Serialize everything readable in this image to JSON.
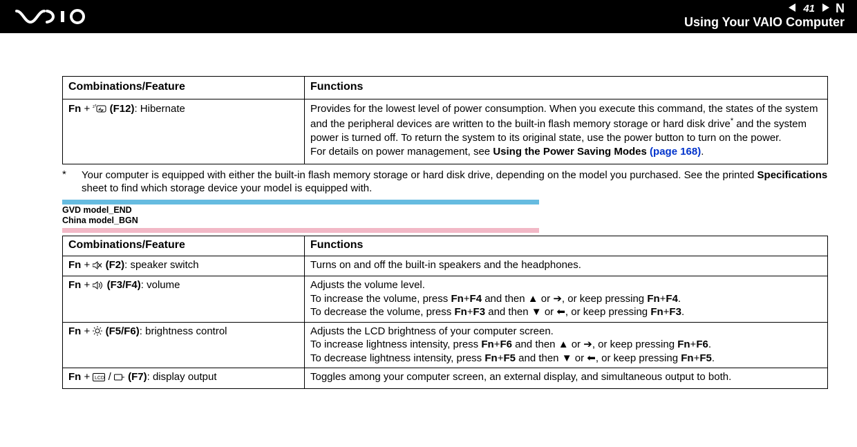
{
  "header": {
    "page_number": "41",
    "title": "Using Your VAIO Computer"
  },
  "table1": {
    "head_left": "Combinations/Feature",
    "head_right": "Functions",
    "row1_left_prefix": "Fn",
    "row1_left_plus": " + ",
    "row1_left_key": " (F12)",
    "row1_left_suffix": ": Hibernate",
    "row1_right_p1": "Provides for the lowest level of power consumption. When you execute this command, the states of the system and the peripheral devices are written to the built-in flash memory storage or hard disk drive",
    "row1_right_sup": "*",
    "row1_right_p1b": " and the system power is turned off. To return the system to its original state, use the power button to turn on the power.",
    "row1_right_p2a": "For details on power management, see ",
    "row1_right_p2b": "Using the Power Saving Modes ",
    "row1_right_link": "(page 168)",
    "row1_right_p2c": "."
  },
  "footnote": {
    "ast": "*",
    "text_a": "Your computer is equipped with either the built-in flash memory storage or hard disk drive, depending on the model you purchased. See the printed ",
    "text_b": "Specifications",
    "text_c": " sheet to find which storage device your model is equipped with."
  },
  "labels": {
    "line1": "GVD model_END",
    "line2": "China model_BGN"
  },
  "table2": {
    "head_left": "Combinations/Feature",
    "head_right": "Functions",
    "r1_left_fn": "Fn",
    "r1_left_rest": " + ",
    "r1_left_key": " (F2)",
    "r1_left_suffix": ": speaker switch",
    "r1_right": "Turns on and off the built-in speakers and the headphones.",
    "r2_left_fn": "Fn",
    "r2_left_rest": " + ",
    "r2_left_key": " (F3/F4)",
    "r2_left_suffix": ": volume",
    "r2_right_l1": "Adjusts the volume level.",
    "r2_right_l2a": "To increase the volume, press ",
    "r2_right_l2b": "Fn",
    "r2_right_l2c": "+",
    "r2_right_l2d": "F4",
    "r2_right_l2e": " and then ",
    "r2_right_l2f": " or ",
    "r2_right_l2g": ", or keep pressing ",
    "r2_right_l2h": "Fn",
    "r2_right_l2i": "+",
    "r2_right_l2j": "F4",
    "r2_right_l2k": ".",
    "r2_right_l3a": "To decrease the volume, press ",
    "r2_right_l3b": "Fn",
    "r2_right_l3c": "+",
    "r2_right_l3d": "F3",
    "r2_right_l3e": " and then ",
    "r2_right_l3f": " or ",
    "r2_right_l3g": ", or keep pressing ",
    "r2_right_l3h": "Fn",
    "r2_right_l3i": "+",
    "r2_right_l3j": "F3",
    "r2_right_l3k": ".",
    "r3_left_fn": "Fn",
    "r3_left_rest": " + ",
    "r3_left_key": " (F5/F6)",
    "r3_left_suffix": ": brightness control",
    "r3_right_l1": "Adjusts the LCD brightness of your computer screen.",
    "r3_right_l2a": "To increase lightness intensity, press ",
    "r3_right_l2b": "Fn",
    "r3_right_l2c": "+",
    "r3_right_l2d": "F6",
    "r3_right_l2e": " and then ",
    "r3_right_l2f": " or ",
    "r3_right_l2g": ", or keep pressing ",
    "r3_right_l2h": "Fn",
    "r3_right_l2i": "+",
    "r3_right_l2j": "F6",
    "r3_right_l2k": ".",
    "r3_right_l3a": "To decrease lightness intensity, press ",
    "r3_right_l3b": "Fn",
    "r3_right_l3c": "+",
    "r3_right_l3d": "F5",
    "r3_right_l3e": " and then ",
    "r3_right_l3f": " or ",
    "r3_right_l3g": ", or keep pressing ",
    "r3_right_l3h": "Fn",
    "r3_right_l3i": "+",
    "r3_right_l3j": "F5",
    "r3_right_l3k": ".",
    "r4_left_fn": "Fn",
    "r4_left_rest": " + ",
    "r4_left_mid": " / ",
    "r4_left_key": " (F7)",
    "r4_left_suffix": ": display output",
    "r4_right": "Toggles among your computer screen, an external display, and simultaneous output to both."
  }
}
